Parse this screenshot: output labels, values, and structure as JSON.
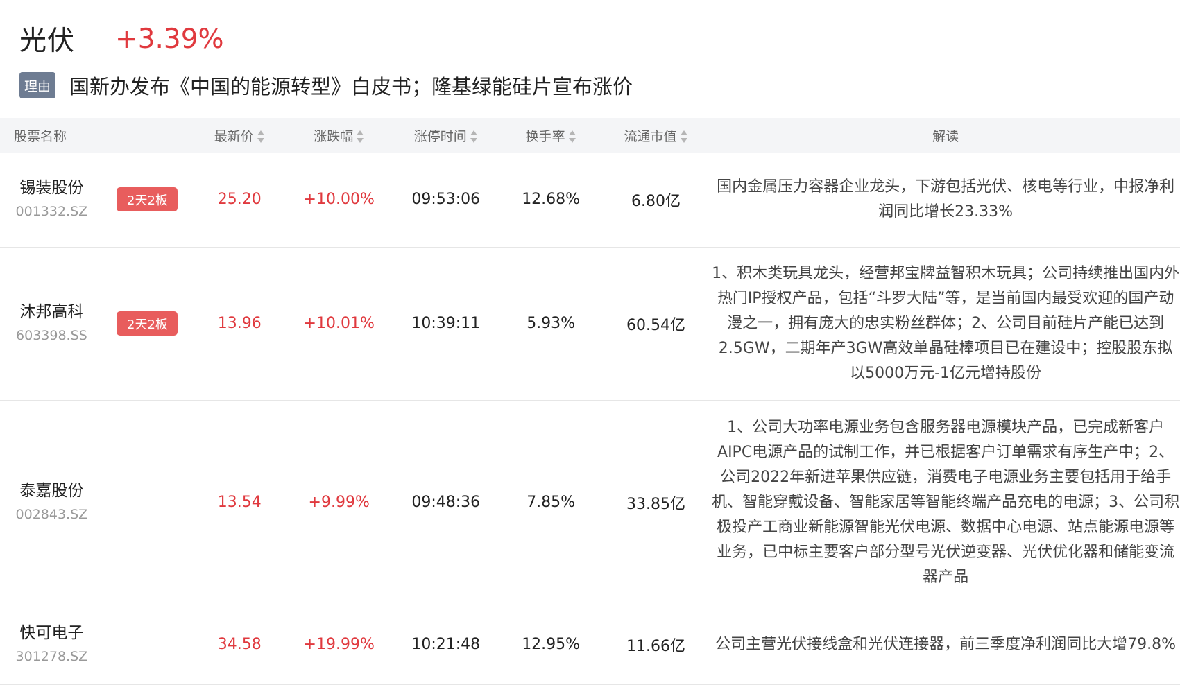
{
  "header": {
    "sector_name": "光伏",
    "sector_change": "+3.39%"
  },
  "reason": {
    "tag": "理由",
    "text": "国新办发布《中国的能源转型》白皮书；隆基绿能硅片宣布涨价"
  },
  "table": {
    "headers": {
      "name": "股票名称",
      "price": "最新价",
      "change": "涨跌幅",
      "limit_time": "涨停时间",
      "turnover": "换手率",
      "float_cap": "流通市值",
      "analysis": "解读"
    },
    "rows": [
      {
        "name": "锡装股份",
        "code": "001332.SZ",
        "badge": "2天2板",
        "price": "25.20",
        "change": "+10.00%",
        "limit_time": "09:53:06",
        "turnover": "12.68%",
        "float_cap": "6.80亿",
        "analysis": "国内金属压力容器企业龙头，下游包括光伏、核电等行业，中报净利润同比增长23.33%"
      },
      {
        "name": "沐邦高科",
        "code": "603398.SS",
        "badge": "2天2板",
        "price": "13.96",
        "change": "+10.01%",
        "limit_time": "10:39:11",
        "turnover": "5.93%",
        "float_cap": "60.54亿",
        "analysis": "1、积木类玩具龙头，经营邦宝牌益智积木玩具；公司持续推出国内外热门IP授权产品，包括“斗罗大陆”等，是当前国内最受欢迎的国产动漫之一，拥有庞大的忠实粉丝群体；2、公司目前硅片产能已达到2.5GW，二期年产3GW高效单晶硅棒项目已在建设中；控股股东拟以5000万元-1亿元增持股份"
      },
      {
        "name": "泰嘉股份",
        "code": "002843.SZ",
        "badge": "",
        "price": "13.54",
        "change": "+9.99%",
        "limit_time": "09:48:36",
        "turnover": "7.85%",
        "float_cap": "33.85亿",
        "analysis": "1、公司大功率电源业务包含服务器电源模块产品，已完成新客户AIPC电源产品的试制工作，并已根据客户订单需求有序生产中；2、公司2022年新进苹果供应链，消费电子电源业务主要包括用于给手机、智能穿戴设备、智能家居等智能终端产品充电的电源；3、公司积极投产工商业新能源智能光伏电源、数据中心电源、站点能源电源等业务，已中标主要客户部分型号光伏逆变器、光伏优化器和储能变流器产品"
      },
      {
        "name": "快可电子",
        "code": "301278.SZ",
        "badge": "",
        "price": "34.58",
        "change": "+19.99%",
        "limit_time": "10:21:48",
        "turnover": "12.95%",
        "float_cap": "11.66亿",
        "analysis": "公司主营光伏接线盒和光伏连接器，前三季度净利润同比大增79.8%"
      }
    ]
  },
  "colors": {
    "up": "#e0393e",
    "badge": "#e85d5d",
    "reason_tag": "#6e7c92",
    "header_bg": "#f4f5f7"
  }
}
